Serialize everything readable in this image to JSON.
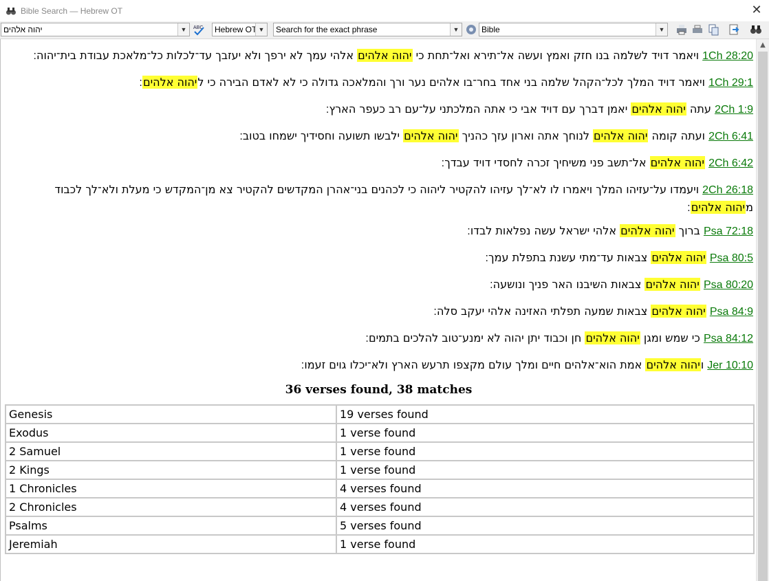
{
  "window": {
    "title": "Bible Search — Hebrew OT",
    "close_glyph": "✕"
  },
  "toolbar": {
    "search_text": "יהוה אלהים",
    "version": "Hebrew OT",
    "search_mode": "Search for the exact phrase",
    "scope": "Bible",
    "dropdown_glyph": "▼"
  },
  "verses": [
    {
      "ref": "1Ch 28:20",
      "segments": [
        {
          "t": "ויאמר דויד לשלמה בנו חזק ואמץ ועשה אל־תירא ואל־תחת כי ",
          "h": false
        },
        {
          "t": "יהוה אלהים",
          "h": true
        },
        {
          "t": " אלהי עמך לא ירפך ולא יעזבך עד־לכלות כל־מלאכת  עבודת בית־יהוה׃",
          "h": false
        }
      ]
    },
    {
      "ref": "1Ch 29:1",
      "segments": [
        {
          "t": "ויאמר דויד המלך לכל־הקהל  שלמה בני אחד בחר־בו אלהים נער ורך והמלאכה גדולה  כי לא לאדם הבירה כי ל",
          "h": false
        },
        {
          "t": "יהוה אלהים",
          "h": true
        },
        {
          "t": "׃",
          "h": false
        }
      ]
    },
    {
      "ref": "2Ch 1:9",
      "segments": [
        {
          "t": "עתה ",
          "h": false
        },
        {
          "t": "יהוה אלהים",
          "h": true
        },
        {
          "t": " יאמן דברך עם דויד אבי כי אתה המלכתני על־עם רב כעפר הארץ׃",
          "h": false
        }
      ]
    },
    {
      "ref": "2Ch 6:41",
      "segments": [
        {
          "t": "ועתה קומה ",
          "h": false
        },
        {
          "t": "יהוה אלהים",
          "h": true
        },
        {
          "t": " לנוחך אתה וארון עזך כהניך ",
          "h": false
        },
        {
          "t": "יהוה אלהים",
          "h": true
        },
        {
          "t": " ילבשו תשועה וחסידיך ישמחו בטוב׃",
          "h": false
        }
      ]
    },
    {
      "ref": "2Ch 6:42",
      "segments": [
        {
          "t": "יהוה אלהים",
          "h": true
        },
        {
          "t": " אל־תשב פני משיחיך זכרה לחסדי דויד  עבדך׃",
          "h": false
        }
      ]
    },
    {
      "ref": "2Ch 26:18",
      "multi": true,
      "segments": [
        {
          "t": "ויעמדו על־עזיהו המלך ויאמרו לו לא־לך עזיהו להקטיר ליהוה כי לכהנים בני־אהרן  המקדשים להקטיר צא מן־המקדש כי מעלת ולא־לך  לכבוד מ",
          "h": false
        },
        {
          "t": "יהוה אלהים",
          "h": true
        },
        {
          "t": "׃",
          "h": false
        }
      ]
    },
    {
      "ref": "Psa 72:18",
      "segments": [
        {
          "t": "ברוך ",
          "h": false
        },
        {
          "t": "יהוה אלהים",
          "h": true
        },
        {
          "t": " אלהי ישראל עשה נפלאות  לבדו׃",
          "h": false
        }
      ]
    },
    {
      "ref": "Psa 80:5",
      "segments": [
        {
          "t": "יהוה אלהים",
          "h": true
        },
        {
          "t": " צבאות עד־מתי  עשנת בתפלת עמך׃",
          "h": false
        }
      ]
    },
    {
      "ref": "Psa 80:20",
      "segments": [
        {
          "t": "יהוה אלהים",
          "h": true
        },
        {
          "t": " צבאות השיבנו  האר פניך  ונושעה׃",
          "h": false
        }
      ]
    },
    {
      "ref": "Psa 84:9",
      "segments": [
        {
          "t": "יהוה אלהים",
          "h": true
        },
        {
          "t": " צבאות שמעה תפלתי האזינה אלהי יעקב סלה׃",
          "h": false
        }
      ]
    },
    {
      "ref": "Psa 84:12",
      "segments": [
        {
          "t": "כי שמש ומגן ",
          "h": false
        },
        {
          "t": "יהוה אלהים",
          "h": true
        },
        {
          "t": " חן וכבוד יתן יהוה לא ימנע־טוב להלכים  בתמים׃",
          "h": false
        }
      ]
    },
    {
      "ref": "Jer 10:10",
      "segments": [
        {
          "t": "ו",
          "h": false
        },
        {
          "t": "יהוה אלהים",
          "h": true
        },
        {
          "t": " אמת הוא־אלהים  חיים ומלך עולם מקצפו תרעש הארץ ולא־יכלו  גוים זעמו׃",
          "h": false
        }
      ]
    }
  ],
  "summary": "36 verses found, 38 matches",
  "books": [
    {
      "book": "Genesis",
      "count": "19 verses found"
    },
    {
      "book": "Exodus",
      "count": "1 verse found"
    },
    {
      "book": "2 Samuel",
      "count": "1 verse found"
    },
    {
      "book": "2 Kings",
      "count": "1 verse found"
    },
    {
      "book": "1 Chronicles",
      "count": "4 verses found"
    },
    {
      "book": "2 Chronicles",
      "count": "4 verses found"
    },
    {
      "book": "Psalms",
      "count": "5 verses found"
    },
    {
      "book": "Jeremiah",
      "count": "1 verse found"
    }
  ],
  "icons": [
    "binoculars-icon",
    "spellcheck-icon",
    "gear-icon",
    "print-icon",
    "copy-icon",
    "export-icon",
    "find-icon"
  ]
}
